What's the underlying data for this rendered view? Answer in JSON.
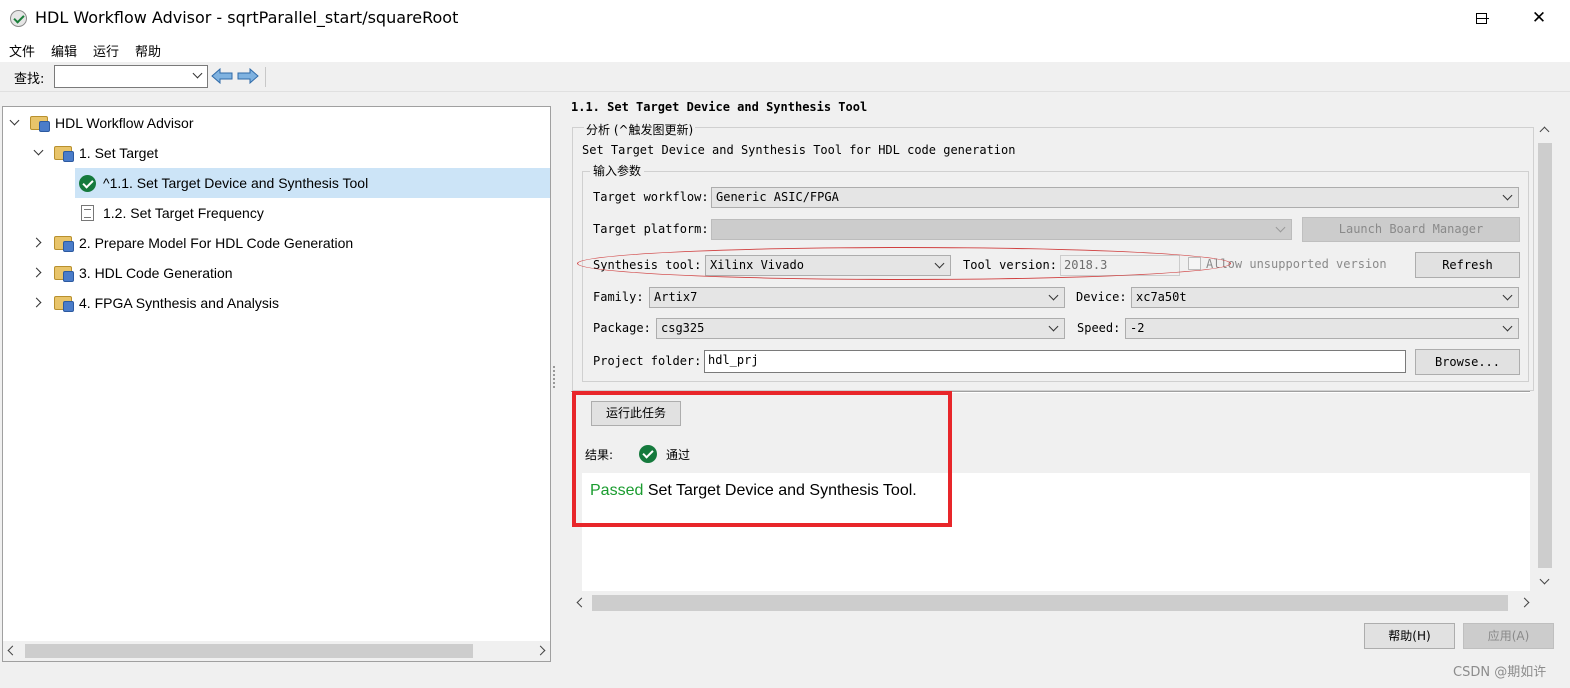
{
  "window": {
    "title": "HDL Workflow Advisor - sqrtParallel_start/squareRoot",
    "minimize_icon": "minimize-icon",
    "maximize_icon": "maximize-icon",
    "close_glyph": "✕"
  },
  "menu": [
    "文件",
    "编辑",
    "运行",
    "帮助"
  ],
  "toolbar": {
    "find_label": "查找:",
    "find_value": "",
    "back_icon": "back-arrow-icon",
    "forward_icon": "forward-arrow-icon"
  },
  "tree": {
    "items": [
      {
        "label": "HDL Workflow Advisor",
        "icon": "folder-icon",
        "expanded": true
      },
      {
        "label": "1. Set Target",
        "icon": "folder-icon",
        "expanded": true
      },
      {
        "label": "^1.1. Set Target Device and Synthesis Tool",
        "icon": "check-icon",
        "selected": true
      },
      {
        "label": "1.2. Set Target Frequency",
        "icon": "document-icon"
      },
      {
        "label": "2. Prepare Model For HDL Code Generation",
        "icon": "folder-icon",
        "expanded": false
      },
      {
        "label": "3. HDL Code Generation",
        "icon": "folder-icon",
        "expanded": false
      },
      {
        "label": "4. FPGA Synthesis and Analysis",
        "icon": "folder-icon",
        "expanded": false
      }
    ]
  },
  "task": {
    "title": "1.1. Set Target Device and Synthesis Tool",
    "analysis_label": "分析 (^触发图更新)",
    "description": "Set Target Device and Synthesis Tool for HDL code generation",
    "input_label": "输入参数",
    "fields": {
      "target_workflow_label": "Target workflow:",
      "target_workflow_value": "Generic ASIC/FPGA",
      "target_platform_label": "Target platform:",
      "target_platform_value": "",
      "launch_board_manager": "Launch Board Manager",
      "synthesis_tool_label": "Synthesis tool:",
      "synthesis_tool_value": "Xilinx Vivado",
      "tool_version_label": "Tool version:",
      "tool_version_value": "2018.3",
      "allow_unsupported": "Allow unsupported version",
      "refresh": "Refresh",
      "family_label": "Family:",
      "family_value": "Artix7",
      "device_label": "Device:",
      "device_value": "xc7a50t",
      "package_label": "Package:",
      "package_value": "csg325",
      "speed_label": "Speed:",
      "speed_value": "-2",
      "project_folder_label": "Project folder:",
      "project_folder_value": "hdl_prj",
      "browse": "Browse..."
    },
    "run_button": "运行此任务",
    "result_label": "结果:",
    "result_status": "通过",
    "result_passed_word": "Passed",
    "result_message": " Set Target Device and Synthesis Tool."
  },
  "footer": {
    "help_button": "帮助(H)",
    "apply_button": "应用(A)"
  },
  "watermark": "CSDN @期如许",
  "colors": {
    "passed": "#1a9c2f",
    "highlight_box": "#e8262a",
    "selection": "#cce4f7"
  }
}
